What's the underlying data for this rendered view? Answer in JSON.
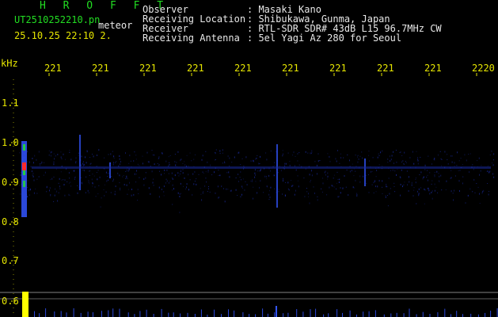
{
  "header": {
    "app_title": "H R O F F T",
    "file_name": "UT2510252210.pn",
    "meteor_tag": "meteor",
    "date_time": "25.10.25 22:10   2.",
    "info": [
      {
        "key": "Observer",
        "value": ": Masaki Kano"
      },
      {
        "key": "Receiving Location",
        "value": ": Shibukawa, Gunma, Japan"
      },
      {
        "key": "Receiver",
        "value": ": RTL-SDR SDR# 43dB L15 96.7MHz CW"
      },
      {
        "key": "Receiving Antenna",
        "value": ": 5el Yagi Az 280 for Seoul"
      }
    ]
  },
  "spectrogram": {
    "y_unit": "kHz",
    "x_ticks": [
      "221",
      "221",
      "221",
      "221",
      "221",
      "221",
      "221",
      "221",
      "221",
      "2220"
    ],
    "y_ticks": [
      "1.1",
      "1.0",
      "0.9",
      "0.8",
      "0.7",
      "0.6"
    ],
    "colors": {
      "background": "#000000",
      "label": "#e6e600",
      "title": "#22dd22",
      "text": "#e8e8e8",
      "noise": "#1a2a9a",
      "signal": "#3355ff",
      "hot": "#ff2a2a",
      "warm": "#22cc44",
      "amplitude": "#ffff00",
      "baseline": "#bbbbbb"
    }
  }
}
